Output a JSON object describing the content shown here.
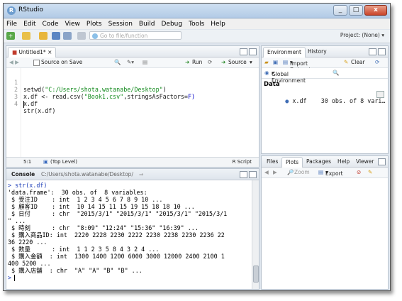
{
  "window": {
    "title": "RStudio",
    "controls": [
      "_",
      "□",
      "x"
    ]
  },
  "menu": [
    "File",
    "Edit",
    "Code",
    "View",
    "Plots",
    "Session",
    "Build",
    "Debug",
    "Tools",
    "Help"
  ],
  "toolbar": {
    "goto_placeholder": "Go to file/function",
    "project": "Project: (None)"
  },
  "editor": {
    "tab": "Untitled1*",
    "source_on_save": "Source on Save",
    "run": "Run",
    "source": "Source",
    "lines": [
      {
        "n": "1",
        "pre": "setwd(",
        "str": "\"C:/Users/shota.watanabe/Desktop\"",
        "post": ")",
        "kw": ""
      },
      {
        "n": "2",
        "pre": "x.df <- read.csv(",
        "str": "\"Book1.csv\"",
        "post": ",stringsAsFactors=",
        "kw": "F)"
      },
      {
        "n": "3",
        "pre": "x.df",
        "str": "",
        "post": "",
        "kw": ""
      },
      {
        "n": "4",
        "pre": "str(x.df)",
        "str": "",
        "post": "",
        "kw": ""
      }
    ],
    "status_pos": "5:1",
    "status_scope": "(Top Level)",
    "status_type": "R Script"
  },
  "console": {
    "title": "Console",
    "path": "C:/Users/shota.watanabe/Desktop/",
    "lines": [
      "> str(x.df)",
      "'data.frame':  30 obs. of  8 variables:",
      " $ 受注ID    : int  1 2 3 4 5 6 7 8 9 10 ...",
      " $ 顧客ID    : int  10 14 15 11 15 19 15 18 18 10 ...",
      " $ 日付      : chr  \"2015/3/1\" \"2015/3/1\" \"2015/3/1\" \"2015/3/1",
      "\" ...",
      " $ 時刻      : chr  \"8:09\" \"12:24\" \"15:36\" \"16:39\" ...",
      " $ 購入商品ID: int  2220 2228 2230 2222 2230 2238 2230 2236 22",
      "36 2220 ...",
      " $ 数量      : int  1 1 2 3 5 8 4 3 2 4 ...",
      " $ 購入金額  : int  1300 1400 1200 6000 3000 12000 2400 2100 1",
      "400 5200 ...",
      " $ 購入店舗  : chr  \"A\" \"A\" \"B\" \"B\" ...",
      ">"
    ]
  },
  "environment": {
    "tabs": [
      "Environment",
      "History"
    ],
    "import_label": "Import Dataset",
    "clear_label": "Clear",
    "scope": "Global Environment",
    "section": "Data",
    "var_name": "x.df",
    "var_desc": "30 obs. of 8 vari…"
  },
  "files": {
    "tabs": [
      "Files",
      "Plots",
      "Packages",
      "Help",
      "Viewer"
    ],
    "zoom": "Zoom",
    "export": "Export"
  }
}
